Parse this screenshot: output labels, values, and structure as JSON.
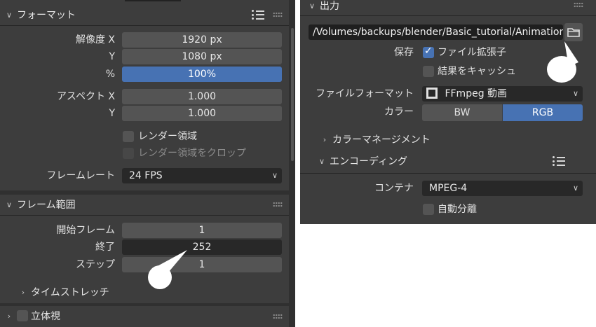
{
  "left": {
    "format": {
      "title": "フォーマット",
      "res_x_label": "解像度 X",
      "res_x": "1920 px",
      "res_y_label": "Y",
      "res_y": "1080 px",
      "pct_label": "%",
      "pct": "100%",
      "aspect_x_label": "アスペクト X",
      "aspect_x": "1.000",
      "aspect_y_label": "Y",
      "aspect_y": "1.000",
      "render_region": "レンダー領域",
      "crop_region": "レンダー領域をクロップ",
      "framerate_label": "フレームレート",
      "framerate": "24 FPS"
    },
    "frame_range": {
      "title": "フレーム範囲",
      "start_label": "開始フレーム",
      "start": "1",
      "end_label": "終了",
      "end": "252",
      "step_label": "ステップ",
      "step": "1",
      "time_stretch": "タイムストレッチ"
    },
    "stereo": {
      "title": "立体視"
    }
  },
  "right": {
    "output": {
      "title": "出力",
      "path": "/Volumes/backups/blender/Basic_tutorial/Animation/",
      "save_label": "保存",
      "file_ext": "ファイル拡張子",
      "cache_result": "結果をキャッシュ",
      "file_format_label": "ファイルフォーマット",
      "file_format": "FFmpeg 動画",
      "color_label": "カラー",
      "color_bw": "BW",
      "color_rgb": "RGB",
      "color_management": "カラーマネージメント"
    },
    "encoding": {
      "title": "エンコーディング",
      "container_label": "コンテナ",
      "container": "MPEG-4",
      "autosplit": "自動分離"
    }
  },
  "colors": {
    "panel_bg": "#303030",
    "subpanel_bg": "#3d3d3d",
    "field_bg": "#545454",
    "accent_blue": "#4772b3"
  },
  "icons": [
    "chevron-down-icon",
    "chevron-right-icon",
    "list-icon",
    "grip-icon",
    "folder-icon",
    "film-icon",
    "checkmark-icon"
  ]
}
